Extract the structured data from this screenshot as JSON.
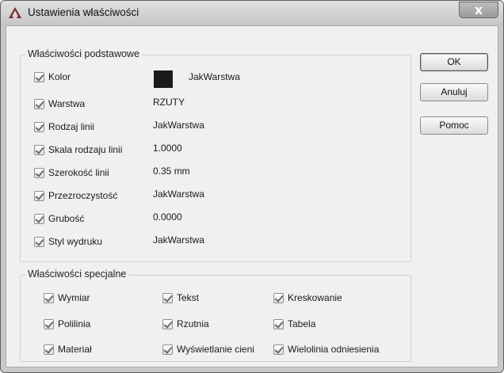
{
  "window": {
    "title": "Ustawienia właściwości",
    "close_label": "x"
  },
  "basic_group": {
    "legend": "Właściwości podstawowe",
    "items": [
      {
        "label": "Kolor",
        "value": "JakWarstwa",
        "checked": true,
        "color": "#1a1a1a"
      },
      {
        "label": "Warstwa",
        "value": "RZUTY",
        "checked": true
      },
      {
        "label": "Rodzaj linii",
        "value": "JakWarstwa",
        "checked": true
      },
      {
        "label": "Skala rodzaju linii",
        "value": "1.0000",
        "checked": true
      },
      {
        "label": "Szerokość linii",
        "value": "0.35 mm",
        "checked": true
      },
      {
        "label": "Przezroczystość",
        "value": "JakWarstwa",
        "checked": true
      },
      {
        "label": "Grubość",
        "value": "0.0000",
        "checked": true
      },
      {
        "label": "Styl wydruku",
        "value": "JakWarstwa",
        "checked": true
      }
    ]
  },
  "special_group": {
    "legend": "Właściwości specjalne",
    "items": [
      {
        "label": "Wymiar",
        "checked": true
      },
      {
        "label": "Tekst",
        "checked": true
      },
      {
        "label": "Kreskowanie",
        "checked": true
      },
      {
        "label": "Polilinia",
        "checked": true
      },
      {
        "label": "Rzutnia",
        "checked": true
      },
      {
        "label": "Tabela",
        "checked": true
      },
      {
        "label": "Materiał",
        "checked": true
      },
      {
        "label": "Wyświetlanie cieni",
        "checked": true
      },
      {
        "label": "Wielolinia odniesienia",
        "checked": true
      }
    ]
  },
  "buttons": {
    "ok": "OK",
    "cancel": "Anuluj",
    "help": "Pomoc"
  }
}
